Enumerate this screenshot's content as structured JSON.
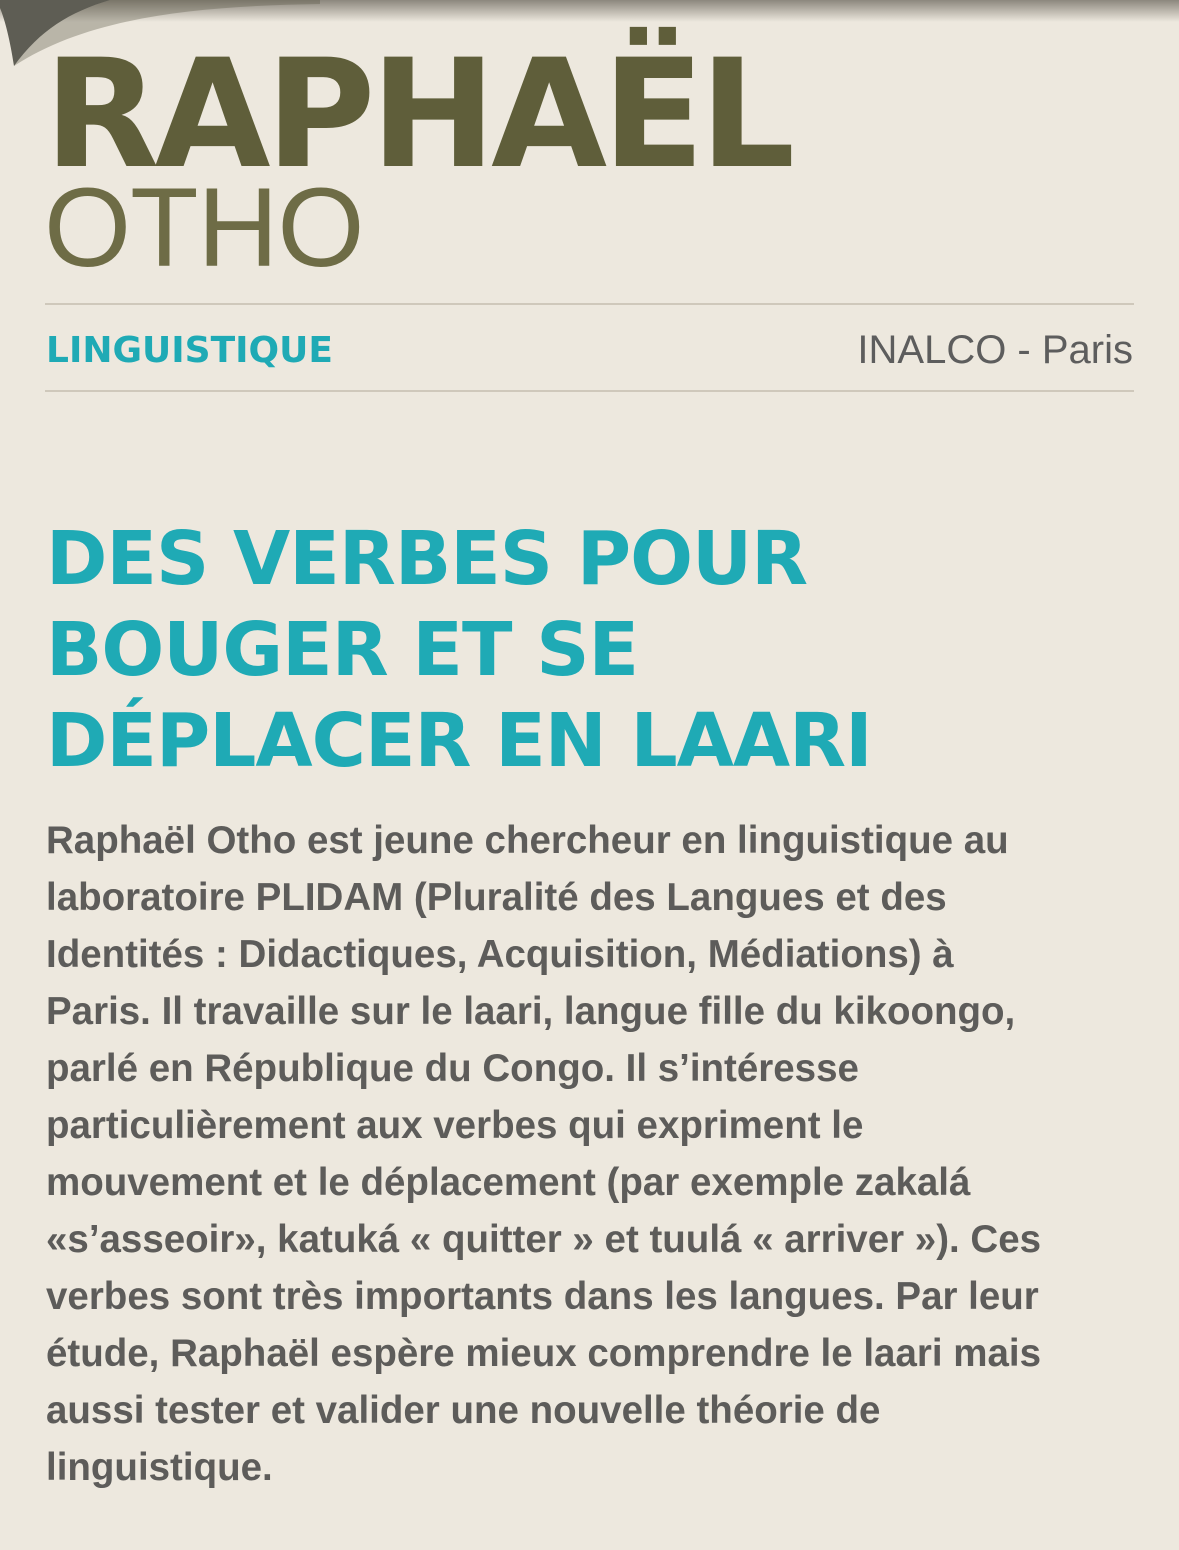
{
  "header": {
    "first_name": "RAPHAËL",
    "last_name": "OTHO"
  },
  "info_bar": {
    "discipline": "LINGUISTIQUE",
    "institution": "INALCO - Paris"
  },
  "article": {
    "headline_lines": [
      "DES VERBES POUR",
      "BOUGER ET SE",
      "DÉPLACER EN LAARI"
    ],
    "body_lines": [
      "Raphaël Otho est jeune chercheur en linguistique au",
      "laboratoire PLIDAM (Pluralité des Langues et des",
      "Identités : Didactiques, Acquisition, Médiations) à",
      "Paris. Il travaille sur le laari, langue fille du kikoongo,",
      "parlé en République du Congo. Il s’intéresse",
      "particulièrement aux verbes qui expriment le",
      "mouvement et le déplacement (par exemple zakalá",
      "«s’asseoir», katuká « quitter » et tuulá « arriver »). Ces",
      "verbes sont très importants dans les langues. Par leur",
      "étude, Raphaël espère mieux comprendre le laari mais",
      "aussi tester et valider une nouvelle théorie de",
      "linguistique."
    ]
  },
  "colors": {
    "background": "#ede8de",
    "name_olive": "#5f5e3a",
    "accent_teal": "#1faab5",
    "body_gray": "#5d5c5a",
    "rule": "#cfc8bb"
  }
}
